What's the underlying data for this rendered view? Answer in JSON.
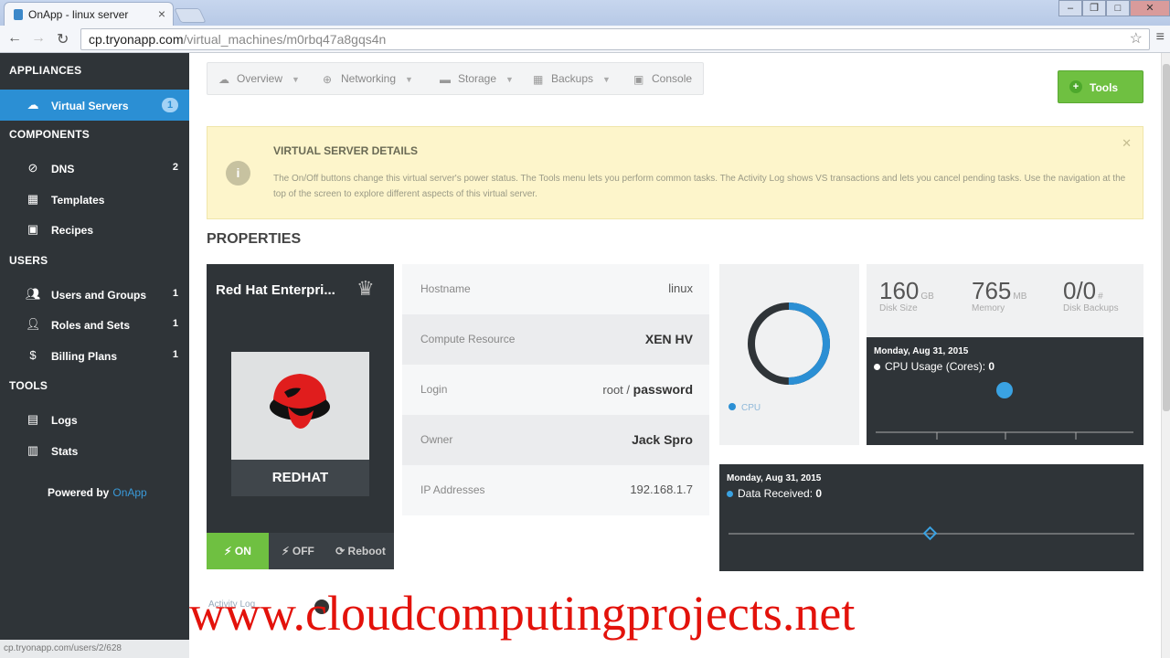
{
  "browser": {
    "tab_title": "OnApp - linux server",
    "url_host": "cp.tryonapp.com",
    "url_path": "/virtual_machines/m0rbq47a8gqs4n",
    "status_url": "cp.tryonapp.com/users/2/628"
  },
  "sidebar": {
    "sections": [
      "APPLIANCES",
      "COMPONENTS",
      "USERS",
      "TOOLS"
    ],
    "items": [
      {
        "label": "Virtual Servers",
        "count": "1",
        "icon": "cloud-icon"
      },
      {
        "label": "DNS",
        "count": "2",
        "icon": "dns-icon"
      },
      {
        "label": "Templates",
        "count": "",
        "icon": "templates-icon"
      },
      {
        "label": "Recipes",
        "count": "",
        "icon": "recipes-icon"
      },
      {
        "label": "Users and Groups",
        "count": "1",
        "icon": "users-icon"
      },
      {
        "label": "Roles and Sets",
        "count": "1",
        "icon": "user-icon"
      },
      {
        "label": "Billing Plans",
        "count": "1",
        "icon": "billing-icon"
      },
      {
        "label": "Logs",
        "count": "",
        "icon": "logs-icon"
      },
      {
        "label": "Stats",
        "count": "",
        "icon": "stats-icon"
      }
    ],
    "powered_by": "Powered by",
    "brand": "OnApp"
  },
  "nav": {
    "tabs": [
      "Overview",
      "Networking",
      "Storage",
      "Backups",
      "Console"
    ],
    "new_button": "Tools"
  },
  "notice": {
    "title": "VIRTUAL SERVER DETAILS",
    "text": "The On/Off buttons change this virtual server's power status. The Tools menu lets you perform common tasks. The Activity Log shows VS transactions and lets you cancel pending tasks. Use the navigation at the top of the screen to explore different aspects of this virtual server."
  },
  "properties": {
    "heading": "PROPERTIES",
    "os_name": "Red Hat Enterpri...",
    "os_label": "REDHAT",
    "power": {
      "on": "ON",
      "off": "OFF",
      "reboot": "Reboot"
    },
    "rows": [
      {
        "key": "Hostname",
        "value": "linux"
      },
      {
        "key": "Compute Resource",
        "value": "XEN HV"
      },
      {
        "key": "Login",
        "user": "root /",
        "password": "password"
      },
      {
        "key": "Owner",
        "value": "Jack Spro"
      },
      {
        "key": "IP Addresses",
        "value": "192.168.1.7"
      }
    ]
  },
  "donut": {
    "legend": "CPU",
    "fraction": 0.5,
    "color_used": "#2b8fd4",
    "color_free": "#2f3438"
  },
  "stats": [
    {
      "value": "160",
      "unit": "GB",
      "label": "Disk Size"
    },
    {
      "value": "765",
      "unit": "MB",
      "label": "Memory"
    },
    {
      "value": "0/0",
      "unit": "#",
      "label": "Disk Backups"
    }
  ],
  "charts": {
    "cpu": {
      "date": "Monday, Aug 31, 2015",
      "series": "CPU Usage (Cores):",
      "value": "0",
      "color": "#3aa2e2"
    },
    "net": {
      "date": "Monday, Aug 31, 2015",
      "series": "Data Received:",
      "value": "0",
      "color": "#3aa2e2"
    }
  },
  "watermark": "www.cloudcomputingprojects.net",
  "bottom_link": "Activity Log"
}
